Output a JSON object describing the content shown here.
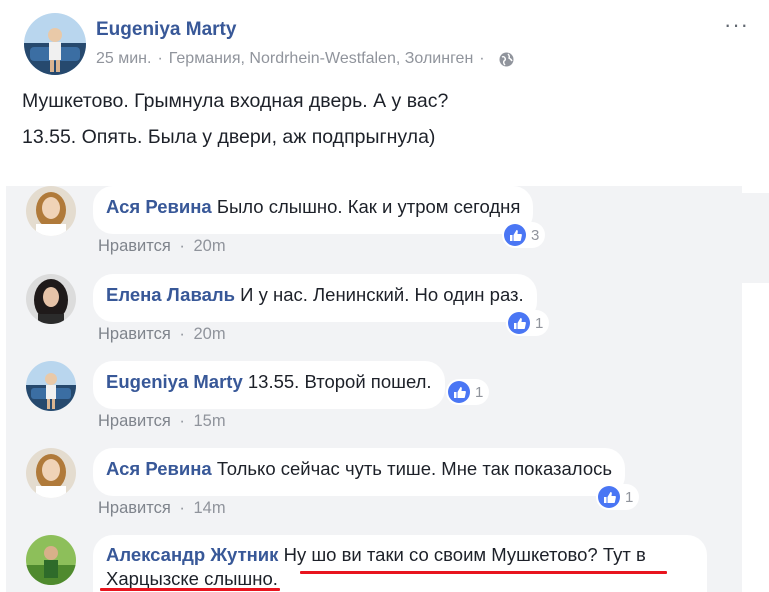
{
  "post": {
    "author": "Eugeniya Marty",
    "time": "25 мин.",
    "location": "Германия, Nordrhein-Westfalen, Золинген",
    "line1": "Мушкетово. Грымнула входная дверь. А у вас?",
    "line2": "13.55. Опять. Была у двери, аж подпрыгнула)",
    "more_label": "···"
  },
  "meta_separator": "·",
  "comments": [
    {
      "name": "Ася Ревина",
      "text": "Было слышно. Как и утром сегодня",
      "like_label": "Нравится",
      "time": "20m",
      "reactions": "3"
    },
    {
      "name": "Елена Лаваль",
      "text": "И у нас. Ленинский. Но один раз.",
      "like_label": "Нравится",
      "time": "20m",
      "reactions": "1"
    },
    {
      "name": "Eugeniya Marty",
      "text": "13.55. Второй пошел.",
      "like_label": "Нравится",
      "time": "15m",
      "reactions": "1"
    },
    {
      "name": "Ася Ревина",
      "text": "Только сейчас чуть тише. Мне так показалось",
      "like_label": "Нравится",
      "time": "14m",
      "reactions": "1"
    },
    {
      "name": "Александр Жутник",
      "text": "Ну шо ви таки со своим Мушкетово? Тут в Харцызске слышно."
    }
  ],
  "colors": {
    "name_link": "#385898",
    "comment_bg": "#f2f3f5",
    "like_badge": "#4a76f4",
    "highlight_underline": "#e8141e",
    "meta": "#90949c"
  },
  "icons": {
    "more": "more-dots-icon",
    "globe": "globe-icon",
    "like": "thumbs-up-icon"
  }
}
